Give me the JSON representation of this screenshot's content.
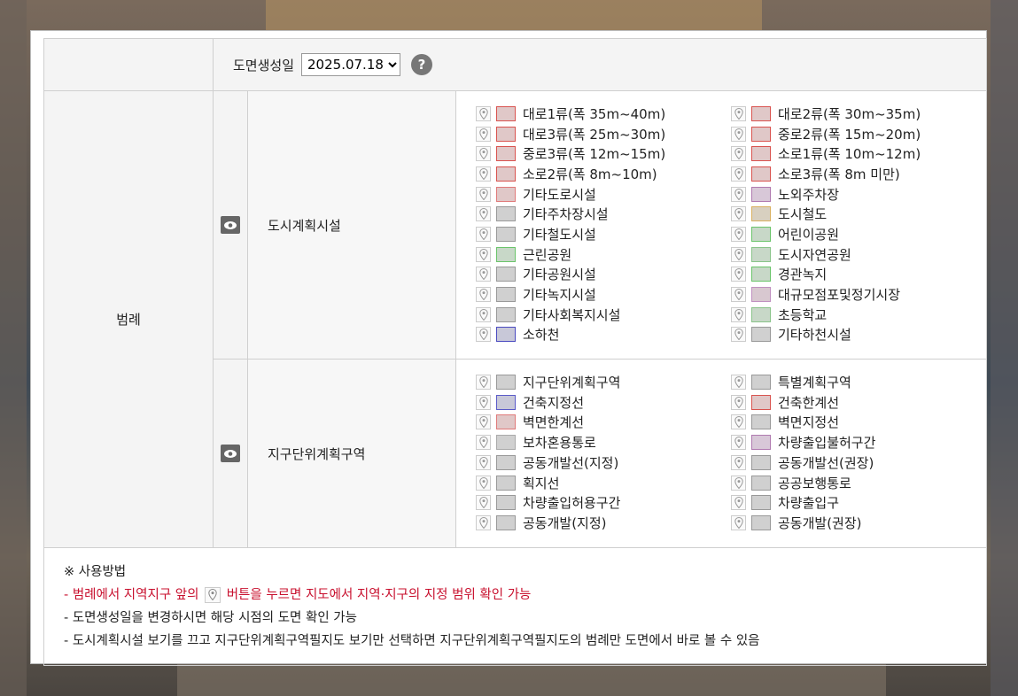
{
  "date_row": {
    "label": "도면생성일",
    "selected_date": "2025.07.18",
    "help_symbol": "?"
  },
  "legend_label": "범례",
  "sections": [
    {
      "title": "도시계획시설",
      "items": [
        {
          "label": "대로1류(폭 35m~40m)",
          "border": "#d9534f",
          "fill": "#e0c8c8"
        },
        {
          "label": "대로2류(폭 30m~35m)",
          "border": "#d9534f",
          "fill": "#e0c8c8"
        },
        {
          "label": "대로3류(폭 25m~30m)",
          "border": "#d9534f",
          "fill": "#e0c8c8"
        },
        {
          "label": "중로2류(폭 15m~20m)",
          "border": "#d9534f",
          "fill": "#e0c8c8"
        },
        {
          "label": "중로3류(폭 12m~15m)",
          "border": "#d9534f",
          "fill": "#e0c8c8"
        },
        {
          "label": "소로1류(폭 10m~12m)",
          "border": "#d9534f",
          "fill": "#e0c8c8"
        },
        {
          "label": "소로2류(폭 8m~10m)",
          "border": "#d9534f",
          "fill": "#e0c8c8"
        },
        {
          "label": "소로3류(폭 8m 미만)",
          "border": "#d9534f",
          "fill": "#e0c8c8"
        },
        {
          "label": "기타도로시설",
          "border": "#e07a7a",
          "fill": "#e0c8c8"
        },
        {
          "label": "노외주차장",
          "border": "#b07ab0",
          "fill": "#d8c8d8"
        },
        {
          "label": "기타주차장시설",
          "border": "#999999",
          "fill": "#d0d0d0"
        },
        {
          "label": "도시철도",
          "border": "#d9b060",
          "fill": "#d8d0c0"
        },
        {
          "label": "기타철도시설",
          "border": "#999999",
          "fill": "#d0d0d0"
        },
        {
          "label": "어린이공원",
          "border": "#6ac46a",
          "fill": "#c8d8c8"
        },
        {
          "label": "근린공원",
          "border": "#6ac46a",
          "fill": "#c8d8c8"
        },
        {
          "label": "도시자연공원",
          "border": "#8ac48a",
          "fill": "#c8d8c8"
        },
        {
          "label": "기타공원시설",
          "border": "#999999",
          "fill": "#d0d0d0"
        },
        {
          "label": "경관녹지",
          "border": "#6ac46a",
          "fill": "#c8d8c8"
        },
        {
          "label": "기타녹지시설",
          "border": "#999999",
          "fill": "#d0d0d0"
        },
        {
          "label": "대규모점포및정기시장",
          "border": "#c090c0",
          "fill": "#d8c8d0"
        },
        {
          "label": "기타사회복지시설",
          "border": "#999999",
          "fill": "#d0d0d0"
        },
        {
          "label": "초등학교",
          "border": "#8ac48a",
          "fill": "#c8d8c8"
        },
        {
          "label": "소하천",
          "border": "#4a4ac0",
          "fill": "#c8c8d8"
        },
        {
          "label": "기타하천시설",
          "border": "#999999",
          "fill": "#d0d0d0"
        }
      ]
    },
    {
      "title": "지구단위계획구역",
      "items": [
        {
          "label": "지구단위계획구역",
          "border": "#999999",
          "fill": "#d0d0d0"
        },
        {
          "label": "특별계획구역",
          "border": "#999999",
          "fill": "#d0d0d0"
        },
        {
          "label": "건축지정선",
          "border": "#5a5ac8",
          "fill": "#c8c8d8"
        },
        {
          "label": "건축한계선",
          "border": "#d9534f",
          "fill": "#e0c8c8"
        },
        {
          "label": "벽면한계선",
          "border": "#e07a7a",
          "fill": "#e0c8c8"
        },
        {
          "label": "벽면지정선",
          "border": "#999999",
          "fill": "#d0d0d0"
        },
        {
          "label": "보차혼용통로",
          "border": "#aaaaaa",
          "fill": "#d0d0d0"
        },
        {
          "label": "차량출입불허구간",
          "border": "#b07ab0",
          "fill": "#d8c8d8"
        },
        {
          "label": "공동개발선(지정)",
          "border": "#999999",
          "fill": "#d0d0d0"
        },
        {
          "label": "공동개발선(권장)",
          "border": "#999999",
          "fill": "#d0d0d0"
        },
        {
          "label": "획지선",
          "border": "#999999",
          "fill": "#d0d0d0"
        },
        {
          "label": "공공보행통로",
          "border": "#999999",
          "fill": "#d0d0d0"
        },
        {
          "label": "차량출입허용구간",
          "border": "#999999",
          "fill": "#d0d0d0"
        },
        {
          "label": "차량출입구",
          "border": "#999999",
          "fill": "#d0d0d0"
        },
        {
          "label": "공동개발(지정)",
          "border": "#999999",
          "fill": "#d0d0d0"
        },
        {
          "label": "공동개발(권장)",
          "border": "#999999",
          "fill": "#d0d0d0"
        }
      ]
    }
  ],
  "notes": {
    "heading": "※ 사용방법",
    "line1_before": "- 범례에서 지역지구 앞의",
    "line1_after": "버튼을 누르면 지도에서 지역·지구의 지정 범위 확인 가능",
    "line2": "- 도면생성일을 변경하시면 해당 시점의 도면 확인 가능",
    "line3": "- 도시계획시설 보기를 끄고 지구단위계획구역필지도 보기만 선택하면 지구단위계획구역필지도의 범례만 도면에서 바로 볼 수 있음"
  },
  "colors": {
    "note_red": "#c8102e",
    "eye_button": "#666666",
    "help_button": "#777777"
  },
  "icons": {
    "eye": "eye-icon",
    "pin": "map-pin-icon",
    "help": "question-icon"
  }
}
